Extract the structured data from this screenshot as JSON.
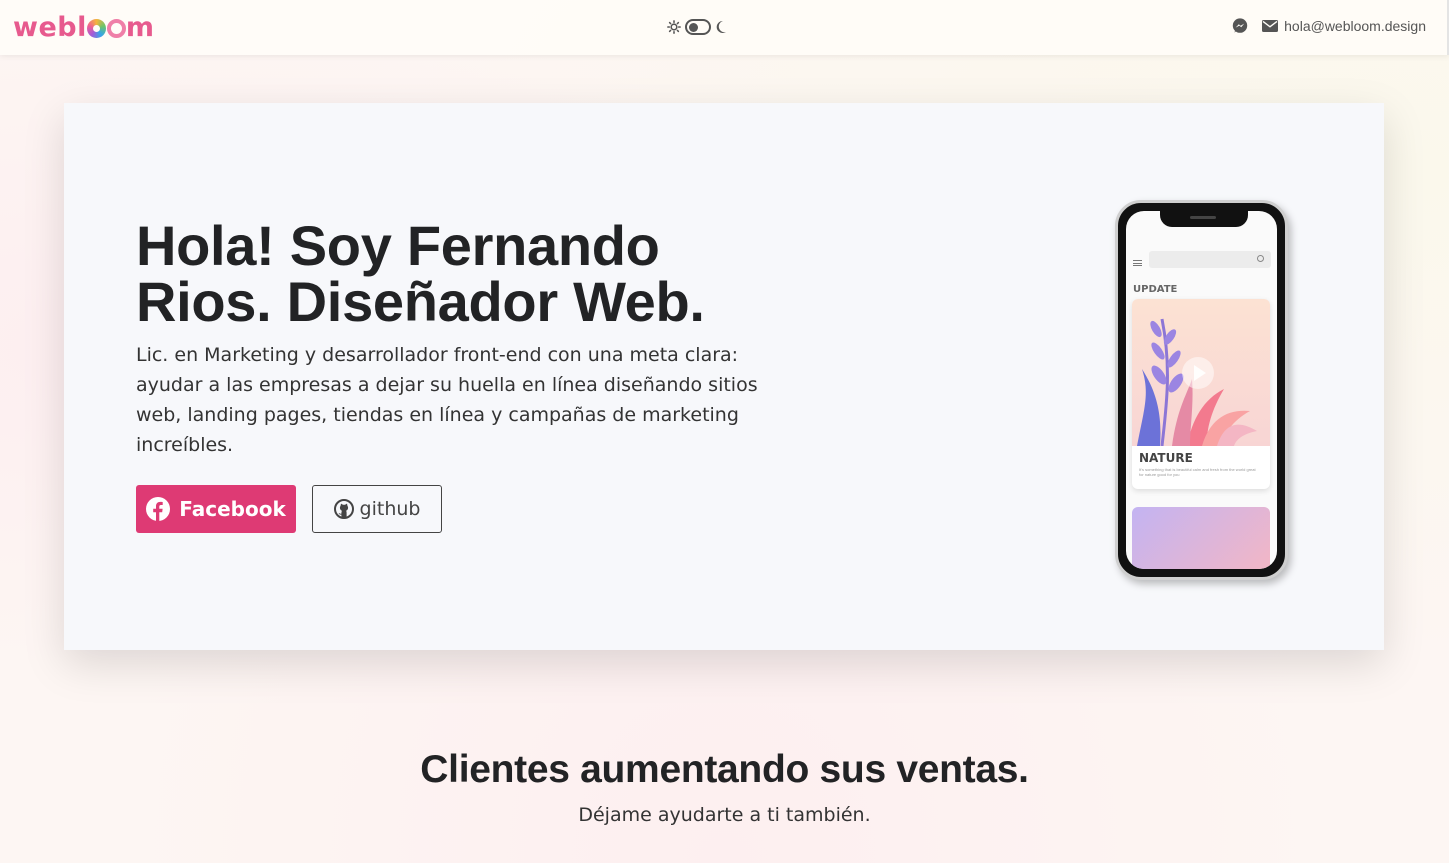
{
  "navbar": {
    "logo": "webloom",
    "email": "hola@webloom.design",
    "icons": [
      "messenger-icon",
      "envelope-icon",
      "sun-icon",
      "moon-icon"
    ]
  },
  "hero": {
    "title": "Hola! Soy Fernando Rios. Diseñador Web.",
    "description": "Lic. en Marketing y desarrollador front-end con una meta clara: ayudar a las empresas a dejar su huella en línea diseñando sitios web, landing pages, tiendas en línea y campañas de marketing increíbles.",
    "facebook_label": "Facebook",
    "github_label": "github",
    "accent_color": "#de3a74"
  },
  "phone": {
    "update_label": "UPDATE",
    "card_title": "NATURE",
    "card_text": "It's something that is beautiful calm and fresh from the world great for nature good for you"
  },
  "section": {
    "title": "Clientes aumentando sus ventas.",
    "subtitle": "Déjame ayudarte a ti también."
  }
}
